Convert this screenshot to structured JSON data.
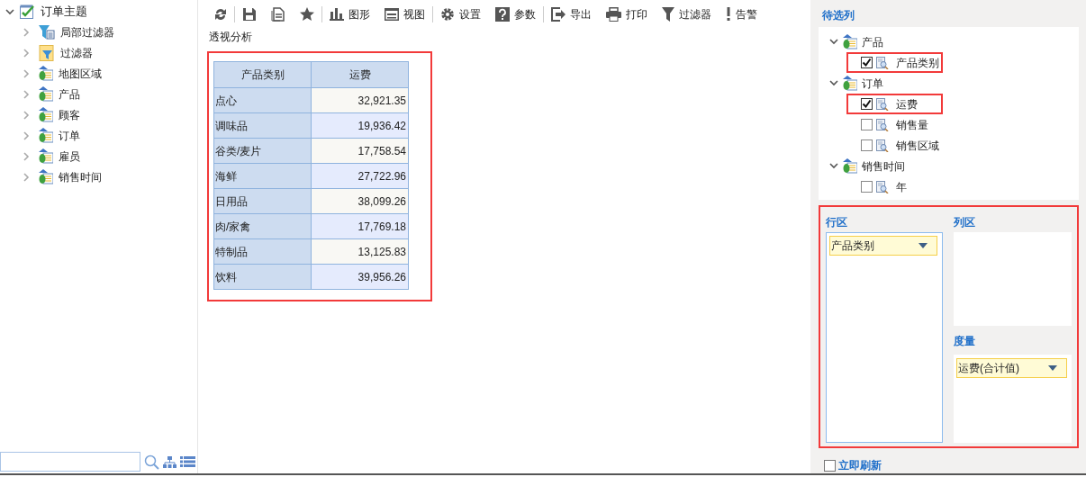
{
  "left_tree": {
    "label": "订单主题",
    "expanded": true,
    "children": [
      {
        "label": "局部过滤器",
        "kind": "local-filter",
        "expanded": false
      },
      {
        "label": "过滤器",
        "kind": "filter",
        "expanded": false
      },
      {
        "label": "地图区域",
        "kind": "dimension",
        "expanded": false
      },
      {
        "label": "产品",
        "kind": "dimension",
        "expanded": false
      },
      {
        "label": "顾客",
        "kind": "dimension",
        "expanded": false
      },
      {
        "label": "订单",
        "kind": "dimension",
        "expanded": false
      },
      {
        "label": "雇员",
        "kind": "dimension",
        "expanded": false
      },
      {
        "label": "销售时间",
        "kind": "dimension",
        "expanded": false
      }
    ]
  },
  "toolbar": [
    {
      "kind": "refresh",
      "divider_after": true
    },
    {
      "kind": "save",
      "divider_after": false
    },
    {
      "kind": "save-as",
      "divider_after": false
    },
    {
      "kind": "favorite",
      "divider_after": true
    },
    {
      "kind": "chart",
      "label": "图形",
      "divider_after": false
    },
    {
      "kind": "view",
      "label": "视图",
      "divider_after": true
    },
    {
      "kind": "settings",
      "label": "设置",
      "divider_after": false
    },
    {
      "kind": "params",
      "label": "参数",
      "divider_after": true
    },
    {
      "kind": "export",
      "label": "导出",
      "divider_after": false
    },
    {
      "kind": "print",
      "label": "打印",
      "divider_after": false
    },
    {
      "kind": "filter",
      "label": "过滤器",
      "divider_after": false
    },
    {
      "kind": "alert",
      "label": "告警",
      "divider_after": false
    }
  ],
  "report_title": "透视分析",
  "pivot_table": {
    "highlighted": true,
    "columns": [
      "产品类别",
      "运费"
    ],
    "rows": [
      {
        "label": "点心",
        "value": "32,921.35"
      },
      {
        "label": "调味品",
        "value": "19,936.42"
      },
      {
        "label": "谷类/麦片",
        "value": "17,758.54"
      },
      {
        "label": "海鲜",
        "value": "27,722.96"
      },
      {
        "label": "日用品",
        "value": "38,099.26"
      },
      {
        "label": "肉/家禽",
        "value": "17,769.18"
      },
      {
        "label": "特制品",
        "value": "13,125.83"
      },
      {
        "label": "饮料",
        "value": "39,956.26"
      }
    ]
  },
  "candidate_columns": {
    "title": "待选列",
    "groups": [
      {
        "label": "产品",
        "expanded": true,
        "fields": [
          {
            "label": "产品类别",
            "checked": true,
            "highlighted": true
          }
        ]
      },
      {
        "label": "订单",
        "expanded": true,
        "fields": [
          {
            "label": "运费",
            "checked": true,
            "highlighted": true
          },
          {
            "label": "销售量",
            "checked": false,
            "highlighted": false
          },
          {
            "label": "销售区域",
            "checked": false,
            "highlighted": false
          }
        ]
      },
      {
        "label": "销售时间",
        "expanded": true,
        "fields": [
          {
            "label": "年",
            "checked": false,
            "highlighted": false
          }
        ]
      }
    ]
  },
  "zones": {
    "highlighted": true,
    "row_zone": {
      "title": "行区",
      "items": [
        {
          "label": "产品类别"
        }
      ]
    },
    "column_zone": {
      "title": "列区"
    },
    "measure_zone": {
      "title": "度量",
      "items": [
        {
          "label": "运费(合计值)"
        }
      ]
    }
  },
  "auto_refresh": {
    "label": "立即刷新",
    "checked": false
  }
}
